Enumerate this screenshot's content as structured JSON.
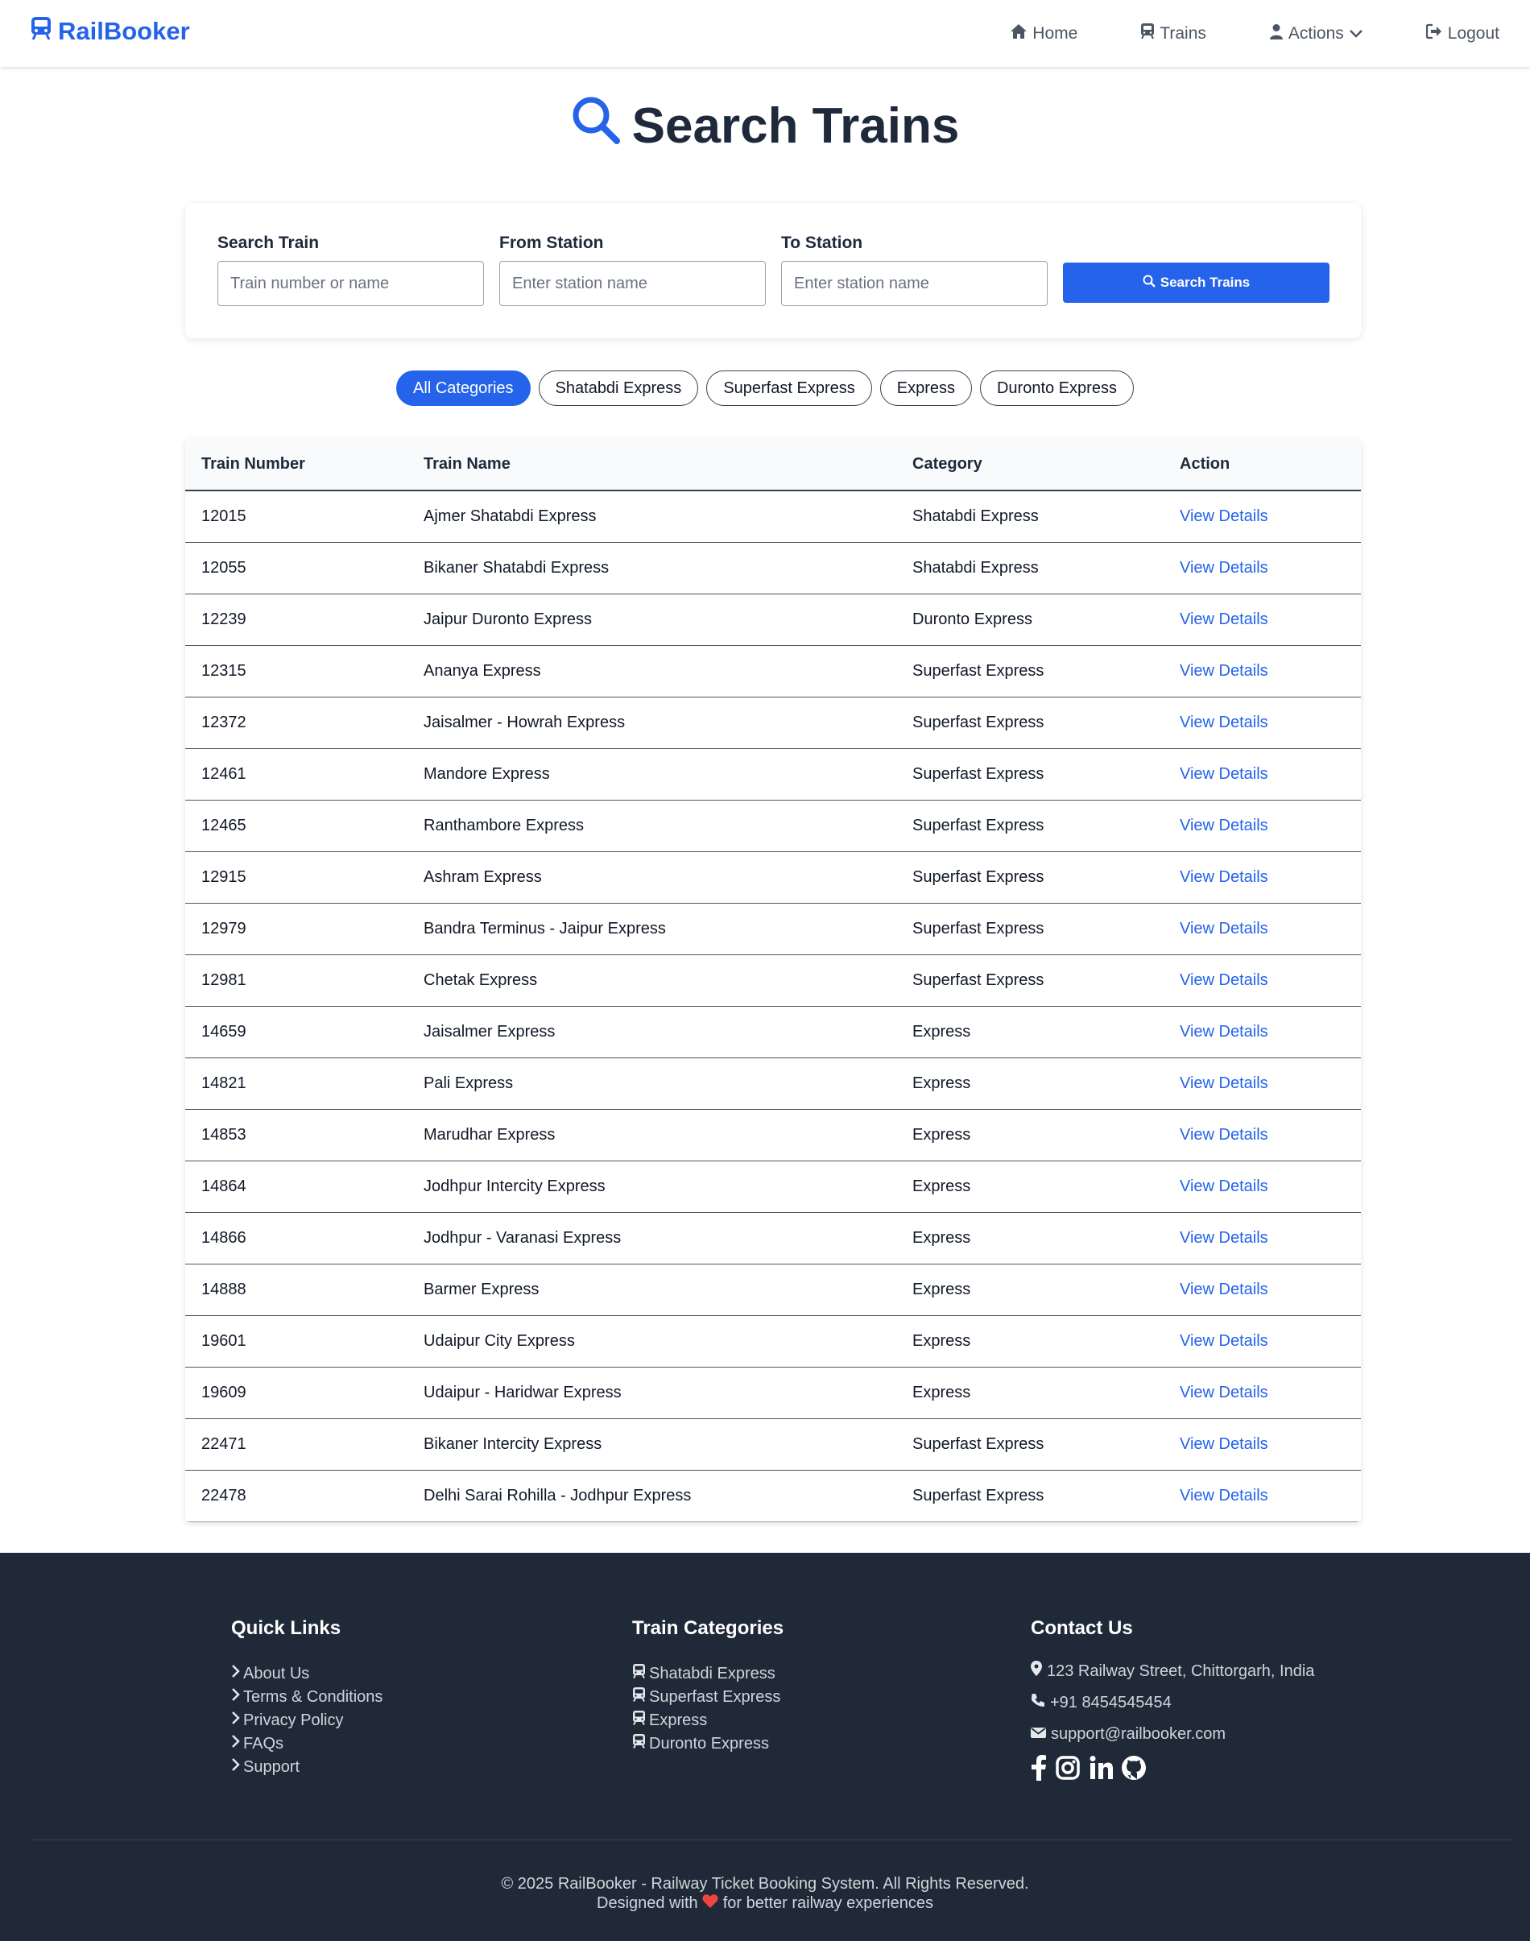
{
  "app": {
    "brand": "RailBooker"
  },
  "nav": {
    "home": "Home",
    "trains": "Trains",
    "actions": "Actions",
    "logout": "Logout"
  },
  "page": {
    "title": "Search Trains"
  },
  "search": {
    "train_label": "Search Train",
    "train_placeholder": "Train number or name",
    "train_value": "",
    "from_label": "From Station",
    "from_placeholder": "Enter station name",
    "from_value": "",
    "to_label": "To Station",
    "to_placeholder": "Enter station name",
    "to_value": "",
    "button_label": "Search Trains"
  },
  "categories": [
    "All Categories",
    "Shatabdi Express",
    "Superfast Express",
    "Express",
    "Duronto Express"
  ],
  "selected_category": "All Categories",
  "table": {
    "headers": [
      "Train Number",
      "Train Name",
      "Category",
      "Action"
    ],
    "rows": [
      {
        "number": "12015",
        "name": "Ajmer Shatabdi Express",
        "category": "Shatabdi Express",
        "action": "View Details"
      },
      {
        "number": "12055",
        "name": "Bikaner Shatabdi Express",
        "category": "Shatabdi Express",
        "action": "View Details"
      },
      {
        "number": "12239",
        "name": "Jaipur Duronto Express",
        "category": "Duronto Express",
        "action": "View Details"
      },
      {
        "number": "12315",
        "name": "Ananya Express",
        "category": "Superfast Express",
        "action": "View Details"
      },
      {
        "number": "12372",
        "name": "Jaisalmer - Howrah Express",
        "category": "Superfast Express",
        "action": "View Details"
      },
      {
        "number": "12461",
        "name": "Mandore Express",
        "category": "Superfast Express",
        "action": "View Details"
      },
      {
        "number": "12465",
        "name": "Ranthambore Express",
        "category": "Superfast Express",
        "action": "View Details"
      },
      {
        "number": "12915",
        "name": "Ashram Express",
        "category": "Superfast Express",
        "action": "View Details"
      },
      {
        "number": "12979",
        "name": "Bandra Terminus - Jaipur Express",
        "category": "Superfast Express",
        "action": "View Details"
      },
      {
        "number": "12981",
        "name": "Chetak Express",
        "category": "Superfast Express",
        "action": "View Details"
      },
      {
        "number": "14659",
        "name": "Jaisalmer Express",
        "category": "Express",
        "action": "View Details"
      },
      {
        "number": "14821",
        "name": "Pali Express",
        "category": "Express",
        "action": "View Details"
      },
      {
        "number": "14853",
        "name": "Marudhar Express",
        "category": "Express",
        "action": "View Details"
      },
      {
        "number": "14864",
        "name": "Jodhpur Intercity Express",
        "category": "Express",
        "action": "View Details"
      },
      {
        "number": "14866",
        "name": "Jodhpur - Varanasi Express",
        "category": "Express",
        "action": "View Details"
      },
      {
        "number": "14888",
        "name": "Barmer Express",
        "category": "Express",
        "action": "View Details"
      },
      {
        "number": "19601",
        "name": "Udaipur City Express",
        "category": "Express",
        "action": "View Details"
      },
      {
        "number": "19609",
        "name": "Udaipur - Haridwar Express",
        "category": "Express",
        "action": "View Details"
      },
      {
        "number": "22471",
        "name": "Bikaner Intercity Express",
        "category": "Superfast Express",
        "action": "View Details"
      },
      {
        "number": "22478",
        "name": "Delhi Sarai Rohilla - Jodhpur Express",
        "category": "Superfast Express",
        "action": "View Details"
      }
    ]
  },
  "footer": {
    "quick_links_title": "Quick Links",
    "quick_links": [
      "About Us",
      "Terms & Conditions",
      "Privacy Policy",
      "FAQs",
      "Support"
    ],
    "categories_title": "Train Categories",
    "categories": [
      "Shatabdi Express",
      "Superfast Express",
      "Express",
      "Duronto Express"
    ],
    "contact_title": "Contact Us",
    "address": "123 Railway Street, Chittorgarh, India",
    "phone": "+91 8454545454",
    "email": "support@railbooker.com",
    "social_icons": [
      "facebook-icon",
      "instagram-icon",
      "linkedin-icon",
      "github-icon"
    ],
    "copyright": "© 2025 RailBooker - Railway Ticket Booking System. All Rights Reserved.",
    "designed_prefix": "Designed with",
    "designed_suffix": "for better railway experiences"
  },
  "colors": {
    "primary": "#2563eb",
    "footer_bg": "#1f2937",
    "heart": "#ef4444",
    "text": "#1e293b"
  }
}
